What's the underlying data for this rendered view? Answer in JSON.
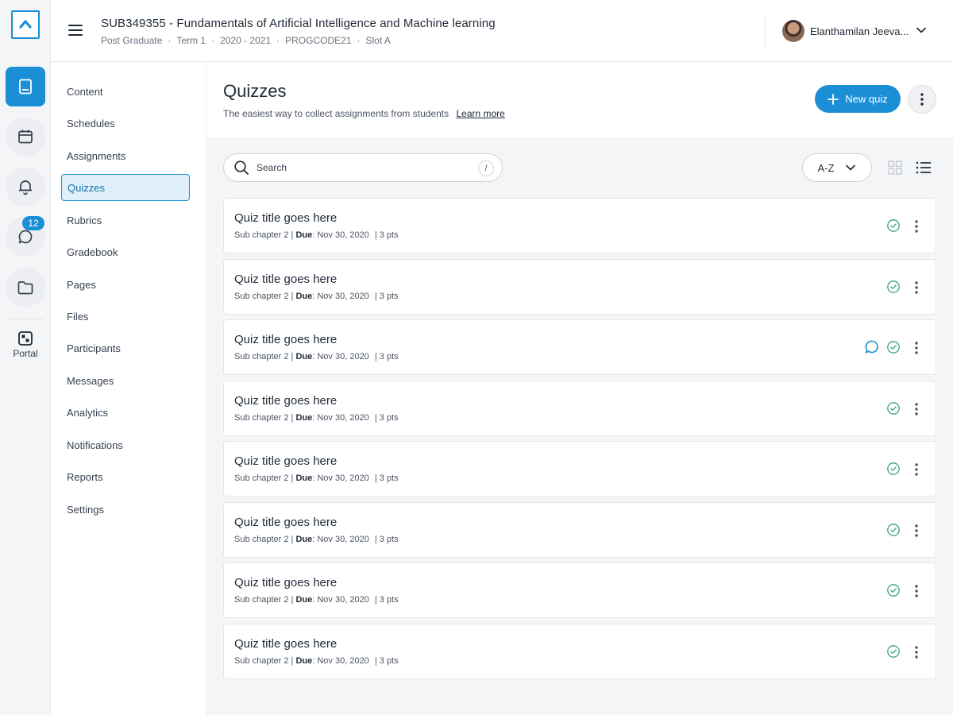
{
  "rail": {
    "badge_count": "12",
    "portal_label": "Portal"
  },
  "header": {
    "course_title": "SUB349355 -  Fundamentals of Artificial Intelligence and Machine learning",
    "meta": [
      "Post Graduate",
      "Term 1",
      "2020 - 2021",
      "PROGCODE21",
      "Slot A"
    ],
    "meta_separator": "·",
    "user_name": "Elanthamilan Jeeva..."
  },
  "course_nav": {
    "items": [
      "Content",
      "Schedules",
      "Assignments",
      "Quizzes",
      "Rubrics",
      "Gradebook",
      "Pages",
      "Files",
      "Participants",
      "Messages",
      "Analytics",
      "Notifications",
      "Reports",
      "Settings"
    ],
    "active": "Quizzes"
  },
  "main": {
    "title": "Quizzes",
    "subtitle": "The easiest way to collect assignments from students",
    "learn_more": "Learn more",
    "new_quiz_label": "New quiz",
    "search_placeholder": "Search",
    "search_shortcut": "/",
    "sort_label": "A-Z"
  },
  "quizzes": [
    {
      "title": "Quiz title goes here",
      "chapter": "Sub chapter 2 |",
      "due_label": "Due",
      "due": ": Nov 30, 2020",
      "pts": "|  3 pts",
      "has_comment": false
    },
    {
      "title": "Quiz title goes here",
      "chapter": "Sub chapter 2 |",
      "due_label": "Due",
      "due": ": Nov 30, 2020",
      "pts": "|  3 pts",
      "has_comment": false
    },
    {
      "title": "Quiz title goes here",
      "chapter": "Sub chapter 2 |",
      "due_label": "Due",
      "due": ": Nov 30, 2020",
      "pts": "|  3 pts",
      "has_comment": true
    },
    {
      "title": "Quiz title goes here",
      "chapter": "Sub chapter 2 |",
      "due_label": "Due",
      "due": ": Nov 30, 2020",
      "pts": "|  3 pts",
      "has_comment": false
    },
    {
      "title": "Quiz title goes here",
      "chapter": "Sub chapter 2 |",
      "due_label": "Due",
      "due": ": Nov 30, 2020",
      "pts": "|  3 pts",
      "has_comment": false
    },
    {
      "title": "Quiz title goes here",
      "chapter": "Sub chapter 2 |",
      "due_label": "Due",
      "due": ": Nov 30, 2020",
      "pts": "|  3 pts",
      "has_comment": false
    },
    {
      "title": "Quiz title goes here",
      "chapter": "Sub chapter 2 |",
      "due_label": "Due",
      "due": ": Nov 30, 2020",
      "pts": "|  3 pts",
      "has_comment": false
    },
    {
      "title": "Quiz title goes here",
      "chapter": "Sub chapter 2 |",
      "due_label": "Due",
      "due": ": Nov 30, 2020",
      "pts": "|  3 pts",
      "has_comment": false
    }
  ],
  "colors": {
    "accent": "#1a8fd6",
    "check": "#3aa27a"
  },
  "icons": [
    "home-logo-icon",
    "book-icon",
    "calendar-icon",
    "bell-icon",
    "chat-icon",
    "folder-icon",
    "portal-icon",
    "hamburger-icon",
    "chevron-down-icon",
    "plus-icon",
    "more-vertical-icon",
    "search-icon",
    "grid-view-icon",
    "list-view-icon",
    "check-circle-icon",
    "comment-icon"
  ]
}
